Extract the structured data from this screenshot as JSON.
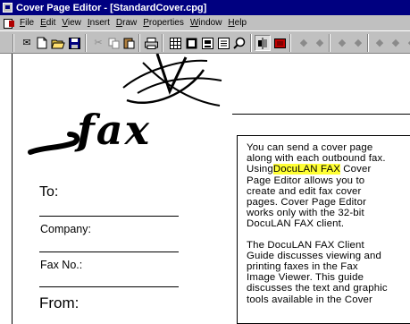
{
  "window": {
    "title": "Cover Page Editor - [StandardCover.cpg]"
  },
  "menu": {
    "items": [
      {
        "u": "F",
        "rest": "ile"
      },
      {
        "u": "E",
        "rest": "dit"
      },
      {
        "u": "V",
        "rest": "iew"
      },
      {
        "u": "I",
        "rest": "nsert"
      },
      {
        "u": "D",
        "rest": "raw"
      },
      {
        "u": "P",
        "rest": "roperties"
      },
      {
        "u": "W",
        "rest": "indow"
      },
      {
        "u": "H",
        "rest": "elp"
      }
    ]
  },
  "toolbar": {
    "icons": [
      "envelope-icon",
      "new-document-icon",
      "open-folder-icon",
      "save-icon",
      "cut-icon",
      "copy-icon",
      "paste-icon",
      "print-icon",
      "grid-icon",
      "frame-icon",
      "object-icon",
      "list-icon",
      "zoom-icon",
      "align-icon",
      "fill-color-icon",
      "first-page-icon",
      "previous-page-icon",
      "next-page-icon",
      "last-page-icon"
    ]
  },
  "document": {
    "fax_logo_text": "fax",
    "labels": {
      "to": "To:",
      "company": "Company:",
      "fax_no": "Fax No.:",
      "from": "From:"
    },
    "textbox": {
      "p1_line1": "You can send a cover page",
      "p1_line2": "along with each outbound fax.",
      "p1_line3_pre": "Using",
      "p1_line3_hl": "DocuLAN FAX",
      "p1_line3_post": "Cover",
      "p1_line4": "Page Editor allows you to",
      "p1_line5": "create and edit fax cover",
      "p1_line6": "pages. Cover Page Editor",
      "p1_line7": "works only with the 32-bit",
      "p1_line8": "DocuLAN FAX client.",
      "p2_line1": "The DocuLAN FAX Client",
      "p2_line2": "Guide discusses viewing and",
      "p2_line3": "printing faxes in the Fax",
      "p2_line4": "Image Viewer. This guide",
      "p2_line5": "discusses the text and graphic",
      "p2_line6": "tools available in the Cover"
    },
    "highlight_color": "#ffff33"
  }
}
